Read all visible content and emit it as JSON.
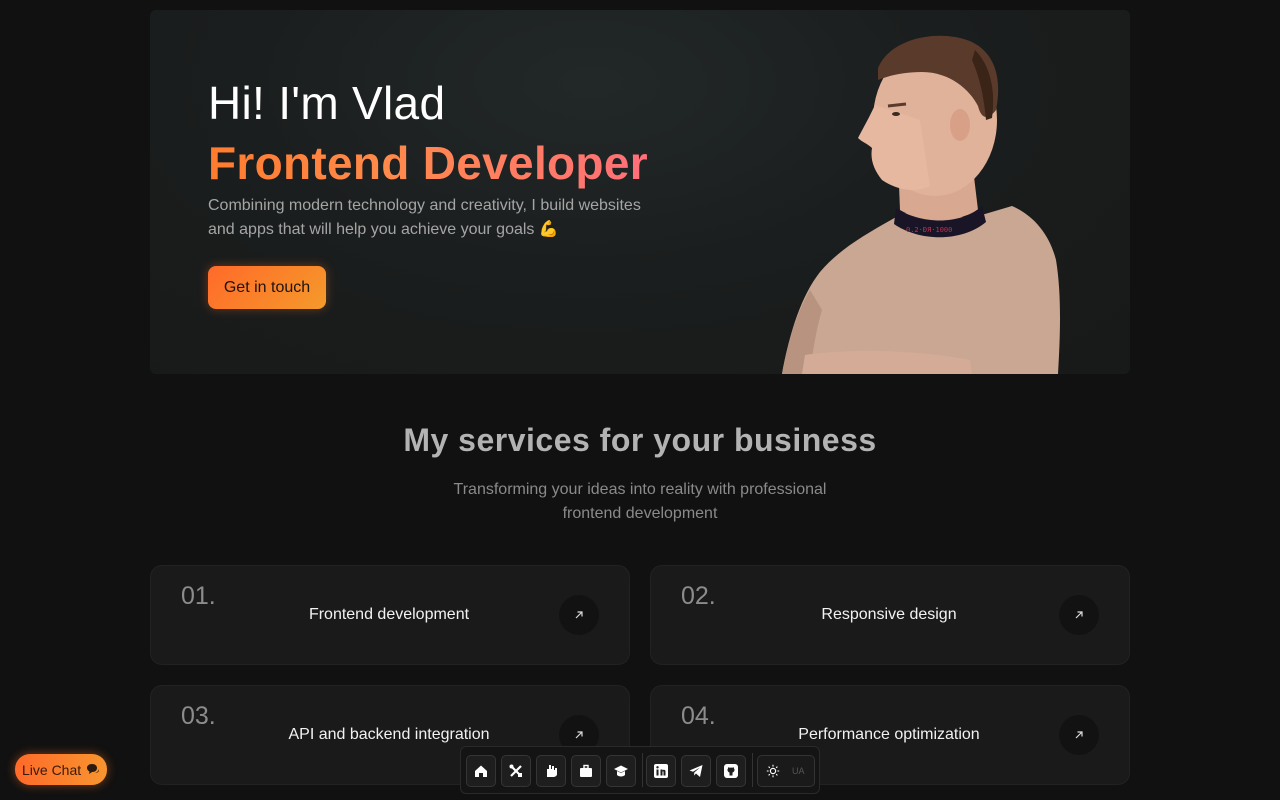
{
  "hero": {
    "greeting": "Hi! I'm Vlad",
    "role": "Frontend Developer",
    "description": "Combining modern technology and creativity, I build websites and apps that will help you achieve your goals 💪",
    "cta_label": "Get in touch"
  },
  "services": {
    "title": "My services for your business",
    "subtitle": "Transforming your ideas into reality with professional frontend development",
    "items": [
      {
        "number": "01.",
        "title": "Frontend development"
      },
      {
        "number": "02.",
        "title": "Responsive design"
      },
      {
        "number": "03.",
        "title": "API and backend integration"
      },
      {
        "number": "04.",
        "title": "Performance optimization"
      }
    ]
  },
  "dock": {
    "items": [
      "home-icon",
      "tools-icon",
      "hand-icon",
      "briefcase-icon",
      "graduation-cap-icon",
      "linkedin-icon",
      "telegram-icon",
      "github-icon"
    ],
    "theme_icon": "sun-icon",
    "language": "UA"
  },
  "live_chat": {
    "label": "Live Chat",
    "icon": "chat-bubbles-icon"
  },
  "colors": {
    "background": "#111111",
    "accent_start": "#ff6a2a",
    "accent_end": "#f7952f",
    "card": "#1a1a1a"
  }
}
